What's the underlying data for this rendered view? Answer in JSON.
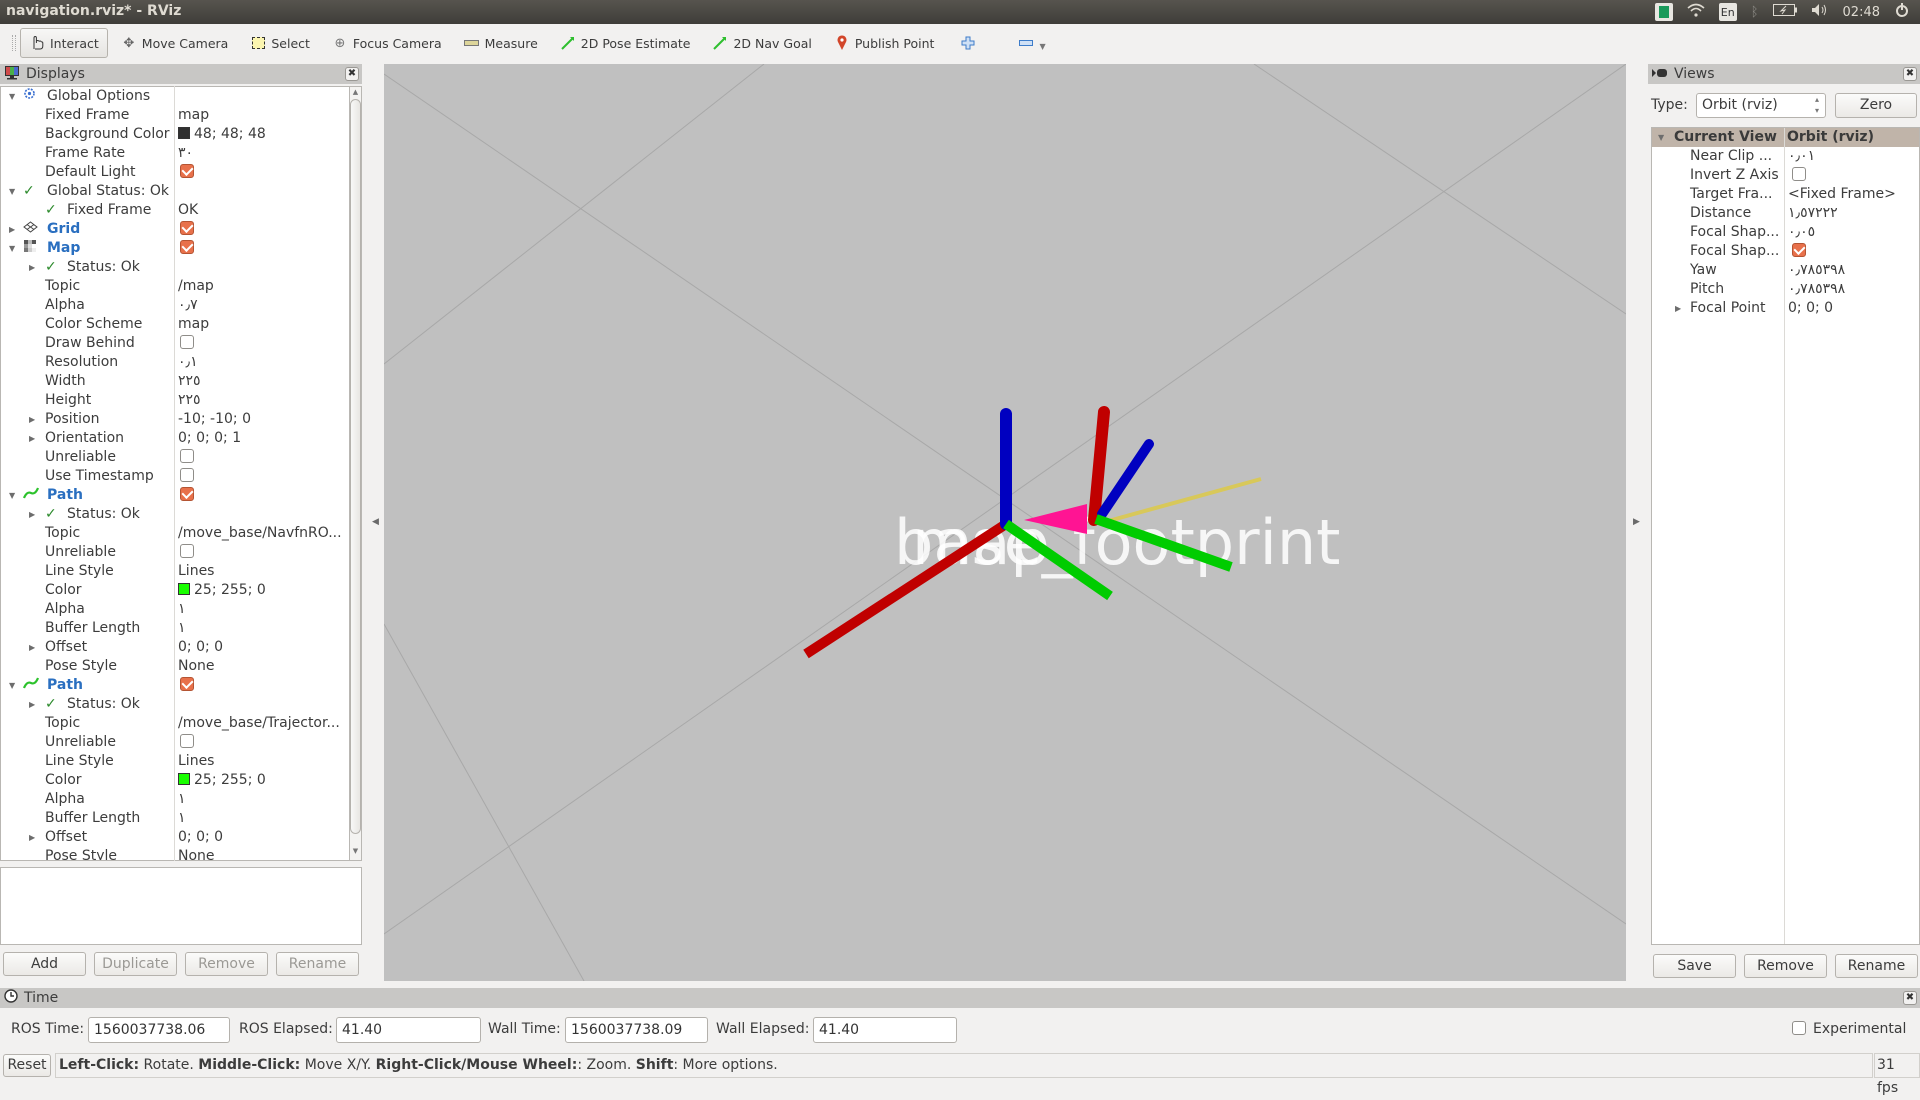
{
  "window": {
    "title": "navigation.rviz* - RViz"
  },
  "tray": {
    "lang": "En",
    "clock": "02:48"
  },
  "toolbar": {
    "tools": [
      {
        "label": "Interact",
        "icon": "hand-pointer-icon",
        "active": true
      },
      {
        "label": "Move Camera",
        "icon": "move-camera-icon"
      },
      {
        "label": "Select",
        "icon": "select-box-icon"
      },
      {
        "label": "Focus Camera",
        "icon": "focus-camera-icon"
      },
      {
        "label": "Measure",
        "icon": "ruler-icon"
      },
      {
        "label": "2D Pose Estimate",
        "icon": "green-arrow-icon"
      },
      {
        "label": "2D Nav Goal",
        "icon": "green-arrow-icon"
      },
      {
        "label": "Publish Point",
        "icon": "map-pin-icon"
      }
    ],
    "add_tool_icon": "plus-icon",
    "remove_tool_icon": "minus-icon"
  },
  "displays": {
    "title": "Displays",
    "rows": [
      {
        "indent": 0,
        "expander": "open",
        "icon": "gear",
        "label": "Global Options",
        "style": "normal"
      },
      {
        "indent": 1,
        "label": "Fixed Frame",
        "value": "map"
      },
      {
        "indent": 1,
        "label": "Background Color",
        "value": "48; 48; 48",
        "swatch": "#303030"
      },
      {
        "indent": 1,
        "label": "Frame Rate",
        "value": "٣٠"
      },
      {
        "indent": 1,
        "label": "Default Light",
        "checkbox": true
      },
      {
        "indent": 0,
        "expander": "open",
        "icon": "check",
        "label": "Global Status: Ok",
        "style": "normal"
      },
      {
        "indent": 1,
        "icon": "check",
        "label": "Fixed Frame",
        "value": "OK"
      },
      {
        "indent": 0,
        "expander": "closed",
        "icon": "grid",
        "label": "Grid",
        "style": "blue",
        "checkbox": true
      },
      {
        "indent": 0,
        "expander": "open",
        "icon": "map",
        "label": "Map",
        "style": "blue",
        "checkbox": true
      },
      {
        "indent": 1,
        "expander": "closed",
        "icon": "check",
        "label": "Status: Ok"
      },
      {
        "indent": 1,
        "label": "Topic",
        "value": "/map"
      },
      {
        "indent": 1,
        "label": "Alpha",
        "value": "٠٫٧"
      },
      {
        "indent": 1,
        "label": "Color Scheme",
        "value": "map"
      },
      {
        "indent": 1,
        "label": "Draw Behind",
        "checkbox": false
      },
      {
        "indent": 1,
        "label": "Resolution",
        "value": "٠٫١"
      },
      {
        "indent": 1,
        "label": "Width",
        "value": "٢٢٥"
      },
      {
        "indent": 1,
        "label": "Height",
        "value": "٢٢٥"
      },
      {
        "indent": 1,
        "expander": "closed",
        "label": "Position",
        "value": "-10; -10; 0"
      },
      {
        "indent": 1,
        "expander": "closed",
        "label": "Orientation",
        "value": "0; 0; 0; 1"
      },
      {
        "indent": 1,
        "label": "Unreliable",
        "checkbox": false
      },
      {
        "indent": 1,
        "label": "Use Timestamp",
        "checkbox": false
      },
      {
        "indent": 0,
        "expander": "open",
        "icon": "path",
        "label": "Path",
        "style": "blue",
        "checkbox": true
      },
      {
        "indent": 1,
        "expander": "closed",
        "icon": "check",
        "label": "Status: Ok"
      },
      {
        "indent": 1,
        "label": "Topic",
        "value": "/move_base/NavfnRO..."
      },
      {
        "indent": 1,
        "label": "Unreliable",
        "checkbox": false
      },
      {
        "indent": 1,
        "label": "Line Style",
        "value": "Lines"
      },
      {
        "indent": 1,
        "label": "Color",
        "value": "25; 255; 0",
        "swatch": "#19ff00"
      },
      {
        "indent": 1,
        "label": "Alpha",
        "value": "١"
      },
      {
        "indent": 1,
        "label": "Buffer Length",
        "value": "١"
      },
      {
        "indent": 1,
        "expander": "closed",
        "label": "Offset",
        "value": "0; 0; 0"
      },
      {
        "indent": 1,
        "label": "Pose Style",
        "value": "None"
      },
      {
        "indent": 0,
        "expander": "open",
        "icon": "path",
        "label": "Path",
        "style": "blue",
        "checkbox": true
      },
      {
        "indent": 1,
        "expander": "closed",
        "icon": "check",
        "label": "Status: Ok"
      },
      {
        "indent": 1,
        "label": "Topic",
        "value": "/move_base/Trajector..."
      },
      {
        "indent": 1,
        "label": "Unreliable",
        "checkbox": false
      },
      {
        "indent": 1,
        "label": "Line Style",
        "value": "Lines"
      },
      {
        "indent": 1,
        "label": "Color",
        "value": "25; 255; 0",
        "swatch": "#19ff00"
      },
      {
        "indent": 1,
        "label": "Alpha",
        "value": "١"
      },
      {
        "indent": 1,
        "label": "Buffer Length",
        "value": "١"
      },
      {
        "indent": 1,
        "expander": "closed",
        "label": "Offset",
        "value": "0; 0; 0"
      },
      {
        "indent": 1,
        "label": "Pose Style",
        "value": "None"
      }
    ],
    "buttons": {
      "add": "Add",
      "duplicate": "Duplicate",
      "remove": "Remove",
      "rename": "Rename"
    }
  },
  "view3d": {
    "labels": [
      "base_footprint",
      "map"
    ],
    "axis_colors": {
      "x": "#cc0000",
      "y": "#00cc00",
      "z": "#0000cc"
    },
    "arrow_color": "#ff1493"
  },
  "views": {
    "title": "Views",
    "type_label": "Type:",
    "type_value": "Orbit (rviz)",
    "zero_label": "Zero",
    "header": {
      "label": "Current View",
      "value": "Orbit (rviz)"
    },
    "rows": [
      {
        "label": "Near Clip ...",
        "value": "٠٫٠١"
      },
      {
        "label": "Invert Z Axis",
        "checkbox": false
      },
      {
        "label": "Target Fra...",
        "value": "<Fixed Frame>"
      },
      {
        "label": "Distance",
        "value": "١٫٥٧٢٢٢"
      },
      {
        "label": "Focal Shap...",
        "value": "٠٫٠٥"
      },
      {
        "label": "Focal Shap...",
        "checkbox": true
      },
      {
        "label": "Yaw",
        "value": "٠٫٧٨٥٣٩٨"
      },
      {
        "label": "Pitch",
        "value": "٠٫٧٨٥٣٩٨"
      },
      {
        "label": "Focal Point",
        "value": "0; 0; 0",
        "expander": "closed"
      }
    ],
    "buttons": {
      "save": "Save",
      "remove": "Remove",
      "rename": "Rename"
    }
  },
  "time": {
    "title": "Time",
    "ros_time_label": "ROS Time:",
    "ros_time": "1560037738.06",
    "ros_elapsed_label": "ROS Elapsed:",
    "ros_elapsed": "41.40",
    "wall_time_label": "Wall Time:",
    "wall_time": "1560037738.09",
    "wall_elapsed_label": "Wall Elapsed:",
    "wall_elapsed": "41.40",
    "experimental_label": "Experimental",
    "experimental": false
  },
  "status": {
    "reset_label": "Reset",
    "parts": [
      {
        "b": "Left-Click:",
        "t": " Rotate. "
      },
      {
        "b": "Middle-Click:",
        "t": " Move X/Y. "
      },
      {
        "b": "Right-Click/Mouse Wheel:",
        "t": ": Zoom. "
      },
      {
        "b": "Shift",
        "t": ": More options."
      }
    ],
    "fps": "31 fps"
  }
}
